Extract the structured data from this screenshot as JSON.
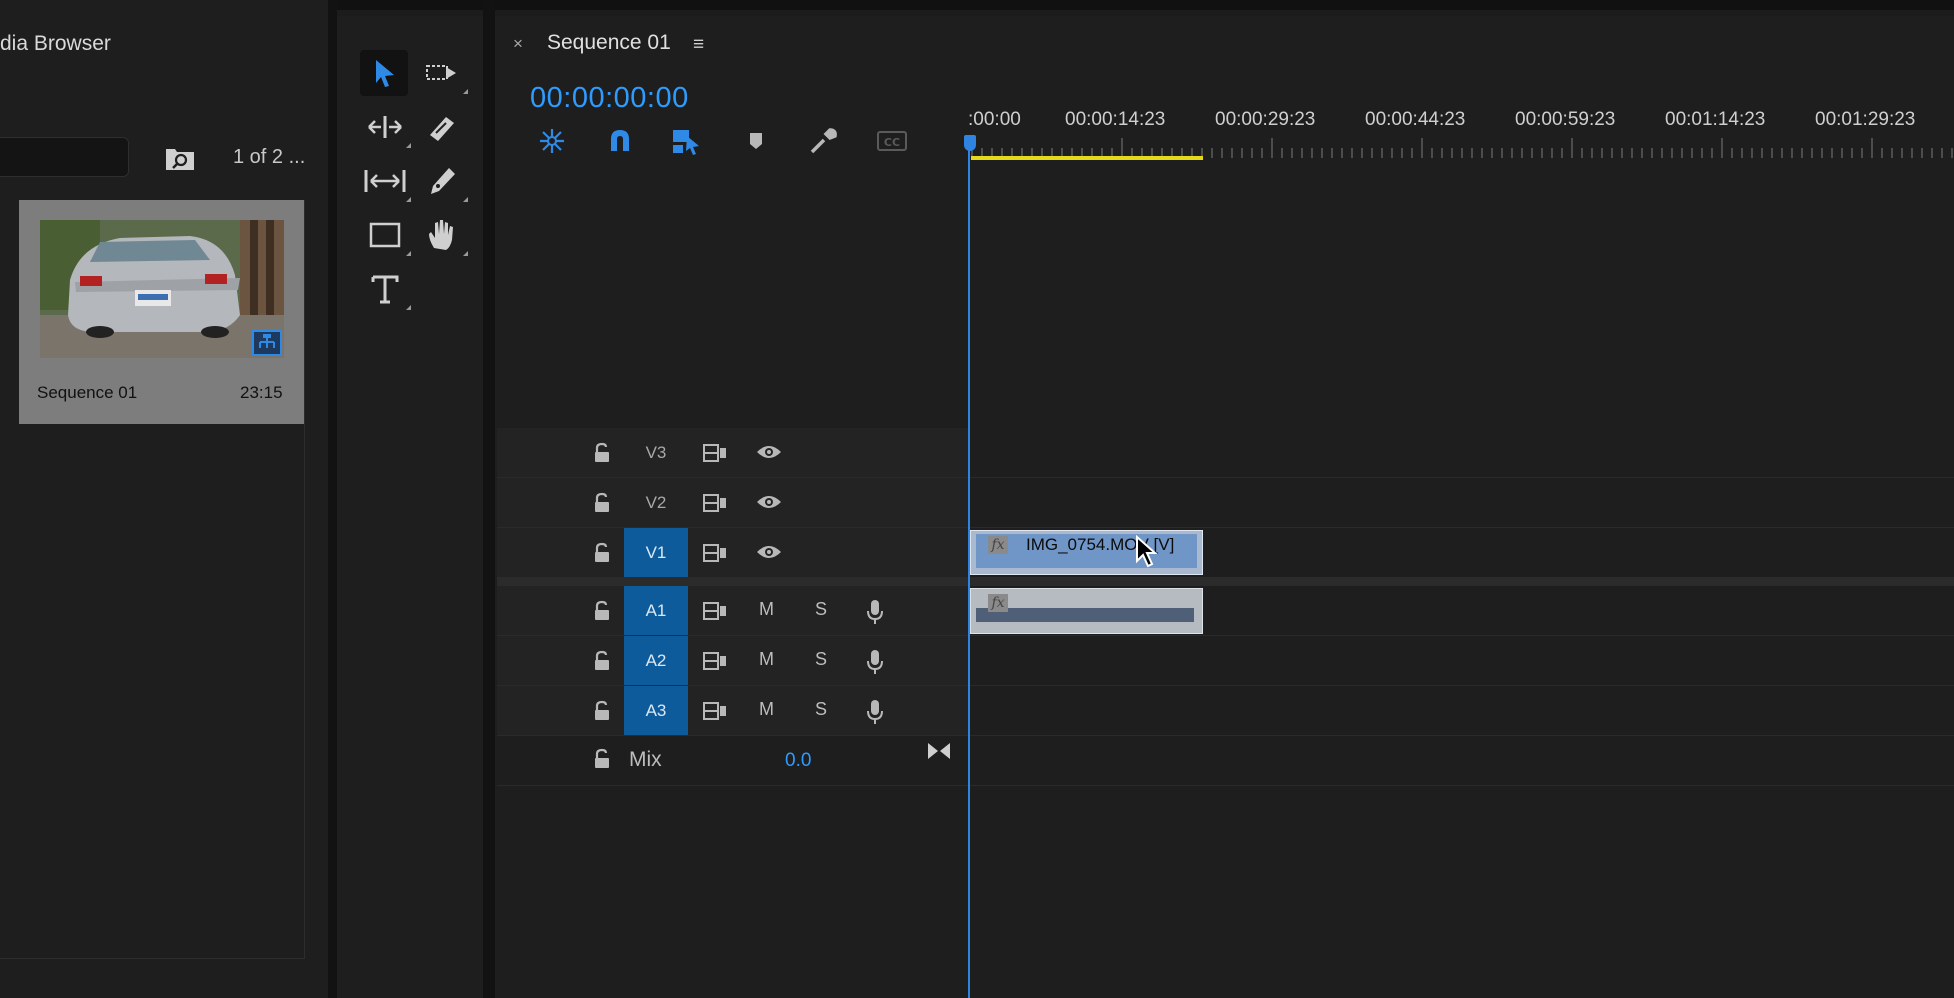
{
  "left_panel": {
    "title": "dia Browser",
    "page_count": "1 of 2 ...",
    "thumbnail": {
      "name": "Sequence 01",
      "duration": "23:15"
    }
  },
  "tools": [
    {
      "name": "selection-tool-icon",
      "selected": true
    },
    {
      "name": "track-select-tool-icon"
    },
    {
      "name": "ripple-edit-tool-icon"
    },
    {
      "name": "razor-tool-icon"
    },
    {
      "name": "slip-tool-icon"
    },
    {
      "name": "pen-tool-icon"
    },
    {
      "name": "rectangle-tool-icon"
    },
    {
      "name": "hand-tool-icon"
    },
    {
      "name": "type-tool-icon"
    }
  ],
  "timeline": {
    "close_glyph": "×",
    "tab_title": "Sequence 01",
    "menu_glyph": "≡",
    "timecode": "00:00:00:00",
    "ruler_labels": [
      ":00:00",
      "00:00:14:23",
      "00:00:29:23",
      "00:00:44:23",
      "00:00:59:23",
      "00:01:14:23",
      "00:01:29:23"
    ],
    "accent_color": "#2e9cff",
    "work_area_color": "#e6d91b"
  },
  "tracks": {
    "video": [
      {
        "name": "V3",
        "targeted": false
      },
      {
        "name": "V2",
        "targeted": false
      },
      {
        "name": "V1",
        "targeted": true
      }
    ],
    "audio": [
      {
        "name": "A1",
        "targeted": true,
        "mute": "M",
        "solo": "S"
      },
      {
        "name": "A2",
        "targeted": true,
        "mute": "M",
        "solo": "S"
      },
      {
        "name": "A3",
        "targeted": true,
        "mute": "M",
        "solo": "S"
      }
    ],
    "mix": {
      "name": "Mix",
      "value": "0.0"
    }
  },
  "clips": {
    "v1_label": "IMG_0754.MOV [V]",
    "fx_label": "fx"
  }
}
